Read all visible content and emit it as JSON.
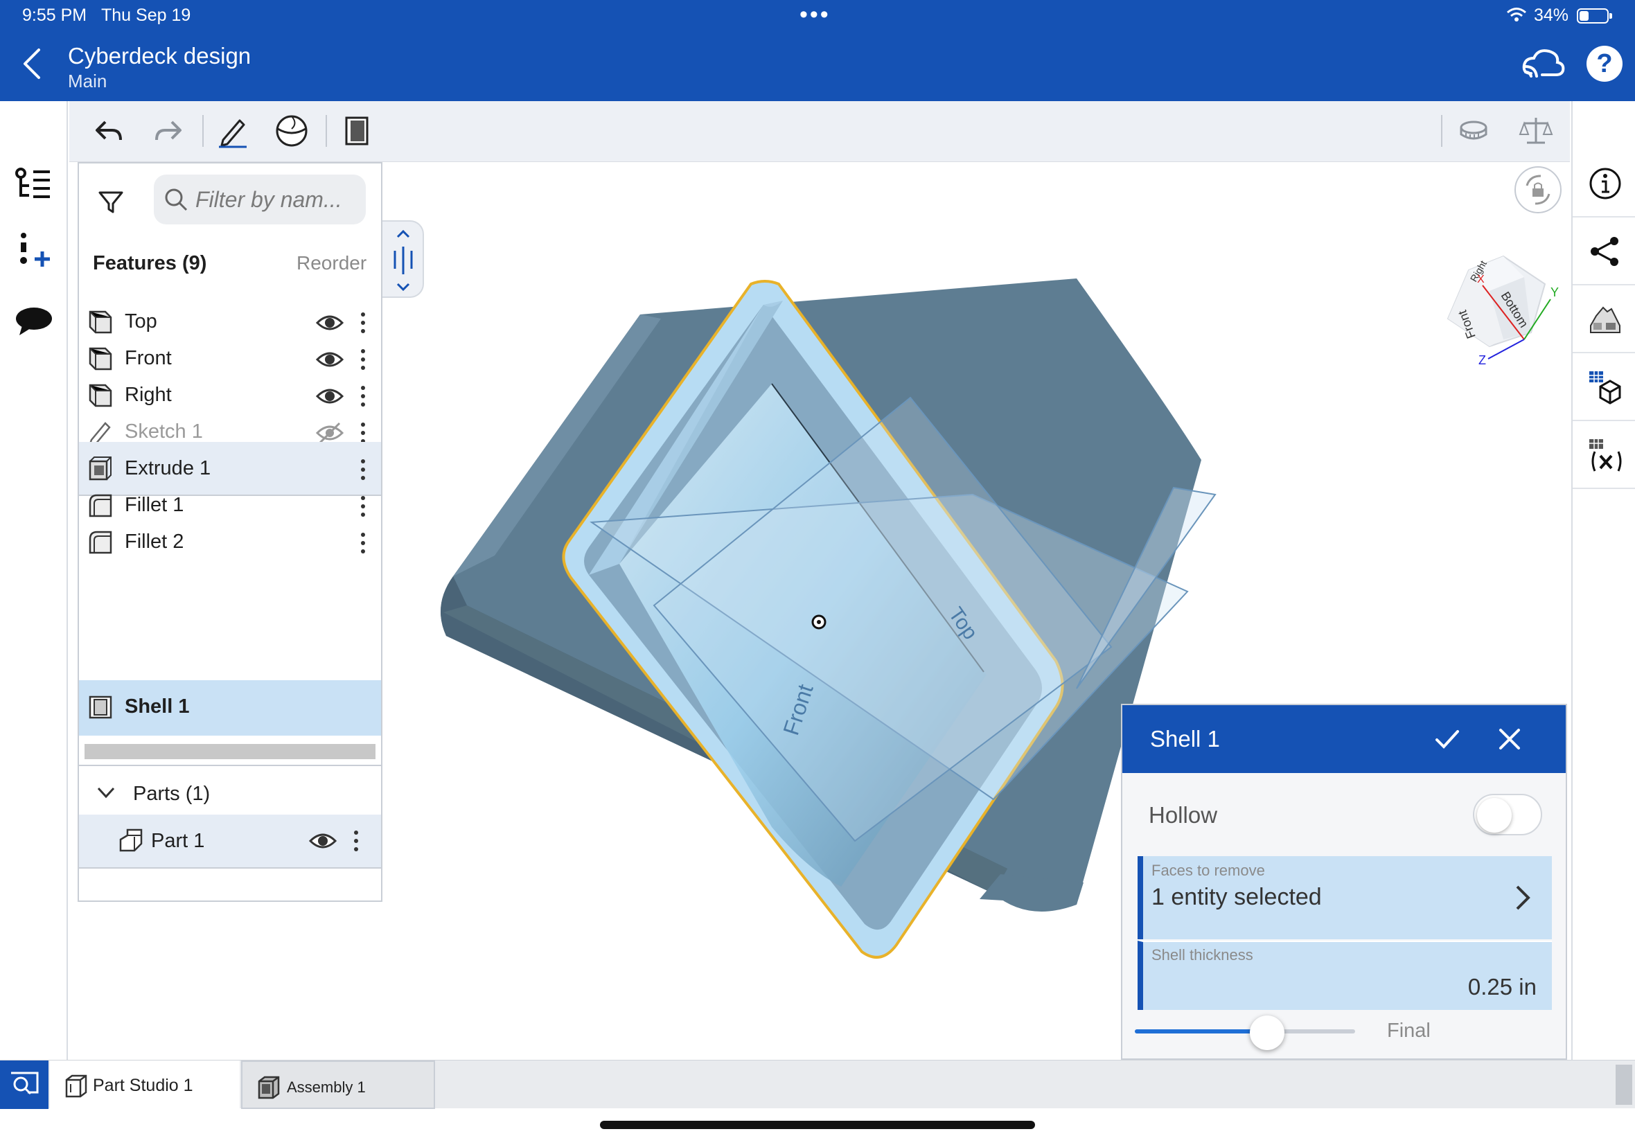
{
  "status_bar": {
    "time": "9:55 PM",
    "date": "Thu Sep 19",
    "multitask_dots": "•••",
    "battery_text": "34%",
    "battery_level": 0.34
  },
  "header": {
    "title": "Cyberdeck design",
    "subtitle": "Main",
    "back_icon": "chevron-left-icon",
    "cloud_icon": "cloud-connect-icon",
    "help_icon": "help-icon",
    "help_glyph": "?"
  },
  "left_rail": {
    "items": [
      "feature-tree-icon",
      "add-feature-icon",
      "comments-icon"
    ]
  },
  "toolbar": {
    "items": [
      "undo-icon",
      "redo-icon",
      "sketch-icon",
      "view-icon",
      "document-icon",
      "measure-icon",
      "mass-properties-icon"
    ]
  },
  "feature_panel": {
    "search_placeholder": "Filter by nam...",
    "features_header": "Features (9)",
    "reorder_label": "Reorder",
    "features": [
      {
        "label": "Top",
        "icon": "plane-icon",
        "visible": true
      },
      {
        "label": "Front",
        "icon": "plane-icon",
        "visible": true
      },
      {
        "label": "Right",
        "icon": "plane-icon",
        "visible": true
      },
      {
        "label": "Sketch 1",
        "icon": "sketch-icon",
        "visible": false
      },
      {
        "label": "Extrude 1",
        "icon": "extrude-icon"
      },
      {
        "label": "Fillet 1",
        "icon": "fillet-icon"
      },
      {
        "label": "Fillet 2",
        "icon": "fillet-icon"
      },
      {
        "label": "Shell 1",
        "icon": "shell-icon"
      }
    ],
    "parts_header": "Parts (1)",
    "part_label": "Part 1"
  },
  "viewport": {
    "plane_labels": [
      "Top",
      "Front"
    ],
    "view_cube": {
      "faces": [
        "Right",
        "Bottom",
        "Front"
      ],
      "axes": [
        "X",
        "Y",
        "Z"
      ]
    }
  },
  "right_rail": {
    "items": [
      "info-icon",
      "share-icon",
      "appearance-icon",
      "configurations-icon",
      "variables-icon"
    ]
  },
  "shell_dialog": {
    "title": "Shell 1",
    "hollow_label": "Hollow",
    "hollow_on": false,
    "faces_caption": "Faces to remove",
    "faces_value": "1 entity selected",
    "thickness_caption": "Shell thickness",
    "thickness_value": "0.25 in",
    "slider_fraction": 0.6,
    "final_label": "Final"
  },
  "tabs": {
    "items": [
      {
        "label": "Part Studio 1",
        "icon": "part-studio-icon",
        "active": true
      },
      {
        "label": "Assembly 1",
        "icon": "assembly-icon",
        "active": false
      }
    ]
  },
  "colors": {
    "brand": "#1552b4",
    "selection": "#c9e1f5",
    "model_body": "#5b7a90",
    "highlight_edge": "#e8b22a"
  }
}
